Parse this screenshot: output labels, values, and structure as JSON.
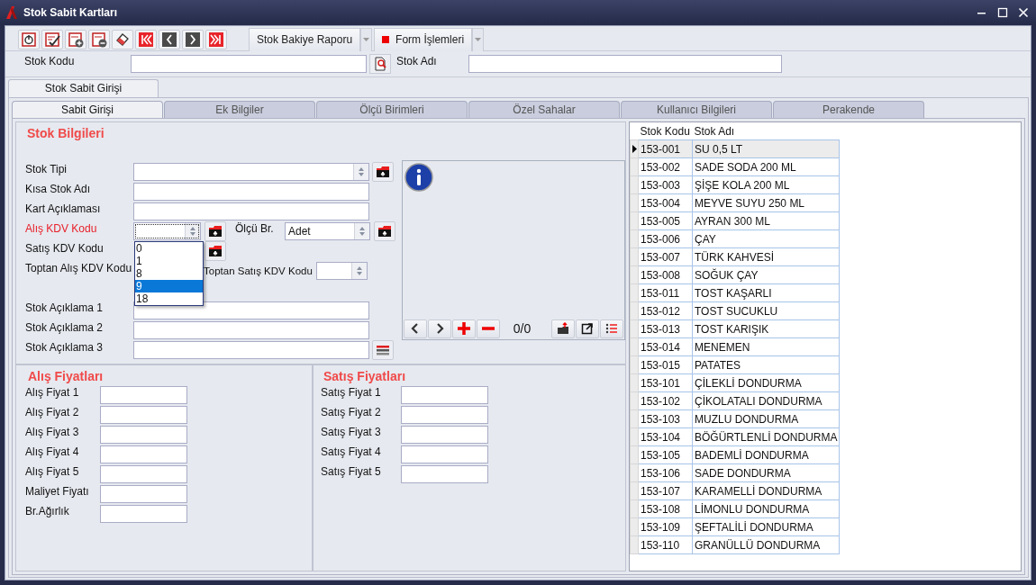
{
  "window": {
    "title": "Stok Sabit Kartları"
  },
  "toolbar": {
    "buttons": [
      {
        "label": "Stok Bakiye Raporu",
        "kind": "plain"
      },
      {
        "label": "Form İşlemleri",
        "kind": "marked"
      }
    ]
  },
  "search": {
    "code_label": "Stok Kodu",
    "name_label": "Stok Adı"
  },
  "outer_tabs": [
    {
      "label": "Stok Sabit Girişi",
      "selected": true
    }
  ],
  "tabs": [
    {
      "label": "Sabit Girişi",
      "selected": true
    },
    {
      "label": "Ek Bilgiler",
      "selected": false
    },
    {
      "label": "Ölçü Birimleri",
      "selected": false
    },
    {
      "label": "Özel Sahalar",
      "selected": false
    },
    {
      "label": "Kullanıcı Bilgileri",
      "selected": false
    },
    {
      "label": "Perakende",
      "selected": false
    }
  ],
  "stok_bilgileri": {
    "title": "Stok Bilgileri",
    "rows": [
      {
        "label": "Stok Tipi",
        "kind": "combo",
        "required": false
      },
      {
        "label": "Kısa Stok Adı",
        "kind": "text",
        "required": false
      },
      {
        "label": "Kart Açıklaması",
        "kind": "text",
        "required": false
      },
      {
        "label": "Alış KDV Kodu",
        "kind": "kdv_unit",
        "required": true,
        "unit_label": "Ölçü Br.",
        "unit_value": "Adet"
      },
      {
        "label": "Satış KDV Kodu",
        "kind": "kdv_covered",
        "required": false
      },
      {
        "label": "Toptan Alış KDV Kodu",
        "kind": "kdv_pair",
        "required": false,
        "pair_label": "Toptan Satış KDV Kodu"
      }
    ],
    "description_rows": [
      {
        "label": "Stok Açıklama 1",
        "kind": "text"
      },
      {
        "label": "Stok Açıklama 2",
        "kind": "text"
      },
      {
        "label": "Stok Açıklama 3",
        "kind": "text_menu"
      }
    ],
    "kdv_dropdown": [
      {
        "label": "0",
        "selected": false
      },
      {
        "label": "1",
        "selected": false
      },
      {
        "label": "8",
        "selected": false
      },
      {
        "label": "9",
        "selected": true
      },
      {
        "label": "18",
        "selected": false
      }
    ]
  },
  "image_panel": {
    "counter": "0/0"
  },
  "alis_fiyatlari": {
    "title": "Alış Fiyatları",
    "fields": [
      "Alış Fiyat 1",
      "Alış Fiyat 2",
      "Alış Fiyat 3",
      "Alış Fiyat 4",
      "Alış Fiyat 5",
      "Maliyet Fiyatı",
      "Br.Ağırlık"
    ]
  },
  "satis_fiyatlari": {
    "title": "Satış Fiyatları",
    "fields": [
      "Satış Fiyat 1",
      "Satış Fiyat 2",
      "Satış Fiyat 3",
      "Satış Fiyat 4",
      "Satış Fiyat 5"
    ]
  },
  "stock_grid": {
    "columns": [
      "Stok Kodu",
      "Stok Adı"
    ],
    "rows": [
      {
        "cells": [
          "153-001",
          "SU 0,5 LT"
        ],
        "selected": true
      },
      {
        "cells": [
          "153-002",
          "SADE SODA 200 ML"
        ],
        "selected": false
      },
      {
        "cells": [
          "153-003",
          "ŞİŞE KOLA 200 ML"
        ],
        "selected": false
      },
      {
        "cells": [
          "153-004",
          "MEYVE SUYU 250 ML"
        ],
        "selected": false
      },
      {
        "cells": [
          "153-005",
          "AYRAN 300 ML"
        ],
        "selected": false
      },
      {
        "cells": [
          "153-006",
          "ÇAY"
        ],
        "selected": false
      },
      {
        "cells": [
          "153-007",
          "TÜRK KAHVESİ"
        ],
        "selected": false
      },
      {
        "cells": [
          "153-008",
          "SOĞUK ÇAY"
        ],
        "selected": false
      },
      {
        "cells": [
          "153-011",
          "TOST KAŞARLI"
        ],
        "selected": false
      },
      {
        "cells": [
          "153-012",
          "TOST SUCUKLU"
        ],
        "selected": false
      },
      {
        "cells": [
          "153-013",
          "TOST KARIŞIK"
        ],
        "selected": false
      },
      {
        "cells": [
          "153-014",
          "MENEMEN"
        ],
        "selected": false
      },
      {
        "cells": [
          "153-015",
          "PATATES"
        ],
        "selected": false
      },
      {
        "cells": [
          "153-101",
          "ÇİLEKLİ DONDURMA"
        ],
        "selected": false
      },
      {
        "cells": [
          "153-102",
          "ÇİKOLATALI DONDURMA"
        ],
        "selected": false
      },
      {
        "cells": [
          "153-103",
          "MUZLU DONDURMA"
        ],
        "selected": false
      },
      {
        "cells": [
          "153-104",
          "BÖĞÜRTLENLİ DONDURMA"
        ],
        "selected": false
      },
      {
        "cells": [
          "153-105",
          "BADEMLİ  DONDURMA"
        ],
        "selected": false
      },
      {
        "cells": [
          "153-106",
          "SADE DONDURMA"
        ],
        "selected": false
      },
      {
        "cells": [
          "153-107",
          "KARAMELLİ DONDURMA"
        ],
        "selected": false
      },
      {
        "cells": [
          "153-108",
          "LİMONLU DONDURMA"
        ],
        "selected": false
      },
      {
        "cells": [
          "153-109",
          "ŞEFTALİLİ DONDURMA"
        ],
        "selected": false
      },
      {
        "cells": [
          "153-110",
          "GRANÜLLÜ DONDURMA"
        ],
        "selected": false
      }
    ]
  }
}
